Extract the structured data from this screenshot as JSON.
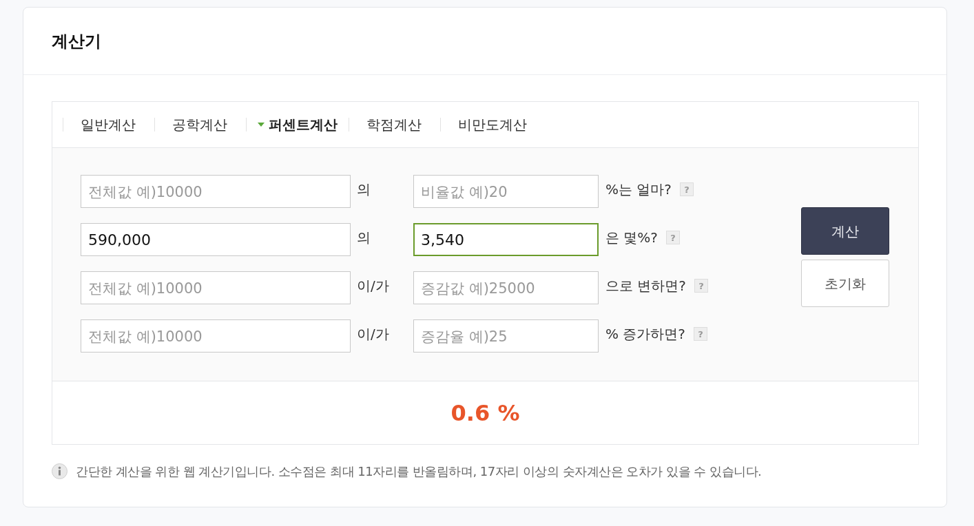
{
  "title": "계산기",
  "tabs": [
    {
      "label": "일반계산",
      "selected": false
    },
    {
      "label": "공학계산",
      "selected": false
    },
    {
      "label": "퍼센트계산",
      "selected": true
    },
    {
      "label": "학점계산",
      "selected": false
    },
    {
      "label": "비만도계산",
      "selected": false
    }
  ],
  "rows": [
    {
      "field_1": {
        "placeholder": "전체값 예)10000",
        "focused": false
      },
      "connector": "의",
      "field_2": {
        "placeholder": "비율값 예)20",
        "focused": false
      },
      "question": "%는 얼마?",
      "help": "?"
    },
    {
      "field_1": {
        "value": "590,000",
        "focused": false
      },
      "connector": "의",
      "field_2": {
        "value": "3,540",
        "focused": true
      },
      "question": "은 몇%?",
      "help": "?"
    },
    {
      "field_1": {
        "placeholder": "전체값 예)10000",
        "focused": false
      },
      "connector": "이/가",
      "field_2": {
        "placeholder": "증감값 예)25000",
        "focused": false
      },
      "question": "으로 변하면?",
      "help": "?"
    },
    {
      "field_1": {
        "placeholder": "전체값 예)10000",
        "focused": false
      },
      "connector": "이/가",
      "field_2": {
        "placeholder": "증감율 예)25",
        "focused": false
      },
      "question": "% 증가하면?",
      "help": "?"
    }
  ],
  "buttons": [
    {
      "label": "계산",
      "kind": "primary"
    },
    {
      "label": "초기화",
      "kind": "secondary"
    }
  ],
  "result": "0.6 %",
  "note": "간단한 계산을 위한 웹 계산기입니다. 소수점은 최대 11자리를 반올림하며, 17자리 이상의 숫자계산은 오차가 있을 수 있습니다."
}
